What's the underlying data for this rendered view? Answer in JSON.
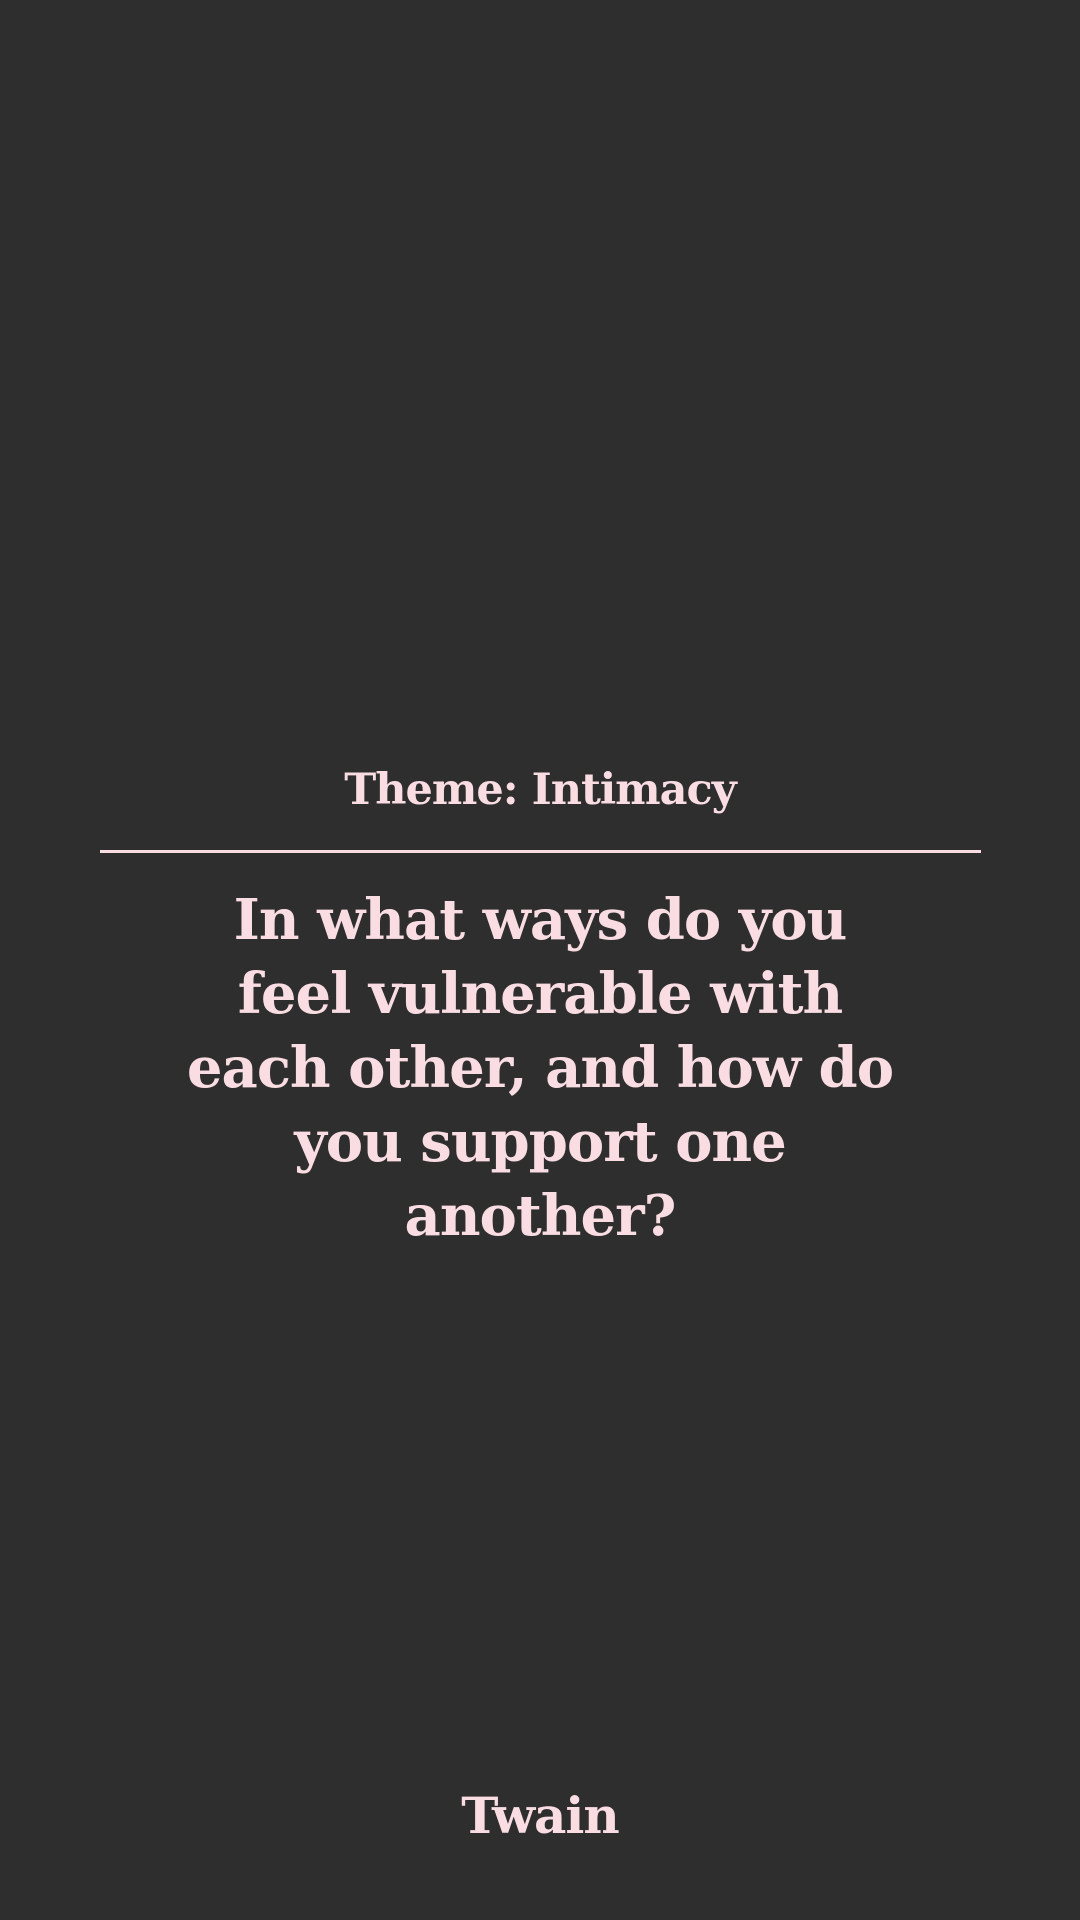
{
  "card": {
    "theme_label": "Theme: Intimacy",
    "question": "In what ways do you feel vulnerable with each other, and how do you support one another?"
  },
  "footer": {
    "brand": "Twain"
  },
  "colors": {
    "background": "#2e2e2e",
    "text": "#f9dde3"
  }
}
